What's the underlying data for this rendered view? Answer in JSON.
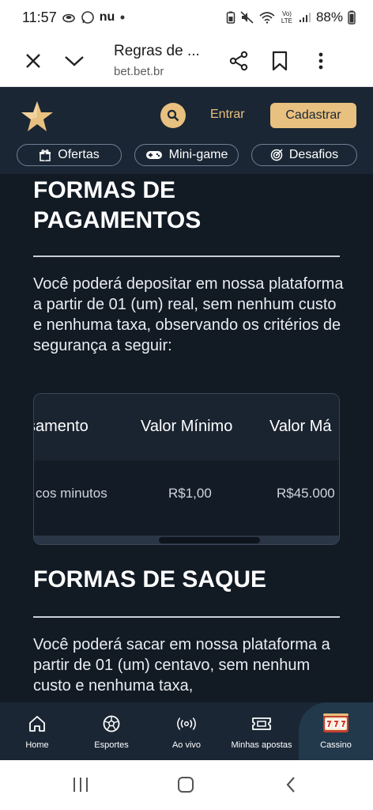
{
  "status_bar": {
    "time": "11:57",
    "nu_label": "nu",
    "network": "Vo) LTE",
    "battery": "88%"
  },
  "browser": {
    "page_title": "Regras de ...",
    "url": "bet.bet.br"
  },
  "header": {
    "login_label": "Entrar",
    "signup_label": "Cadastrar",
    "pills": [
      {
        "label": "Ofertas",
        "icon": "gift-icon"
      },
      {
        "label": "Mini-game",
        "icon": "gamepad-icon"
      },
      {
        "label": "Desafios",
        "icon": "target-icon"
      }
    ]
  },
  "content": {
    "payments_heading": "FORMAS DE PAGAMENTOS",
    "payments_text": "Você poderá depositar em nossa plataforma a partir de 01 (um) real, sem nenhum custo e nenhuma taxa, observando os critérios de segurança a seguir:",
    "table": {
      "headers": [
        "samento",
        "Valor Mínimo",
        "Valor Má"
      ],
      "row": [
        "cos minutos",
        "R$1,00",
        "R$45.000"
      ]
    },
    "withdraw_heading": "FORMAS DE SAQUE",
    "withdraw_text": "Você poderá sacar em nossa plataforma a partir de 01 (um) centavo, sem nenhum custo e nenhuma taxa,"
  },
  "bottom_nav": {
    "items": [
      {
        "label": "Home",
        "icon": "home-icon"
      },
      {
        "label": "Esportes",
        "icon": "soccer-ball-icon"
      },
      {
        "label": "Ao vivo",
        "icon": "live-icon"
      },
      {
        "label": "Minhas apostas",
        "icon": "ticket-icon"
      },
      {
        "label": "Cassino",
        "icon": "slot-machine-icon"
      }
    ]
  },
  "colors": {
    "brand_gold": "#e8c07f",
    "header_bg": "#1a2634",
    "content_bg": "#121a24"
  }
}
